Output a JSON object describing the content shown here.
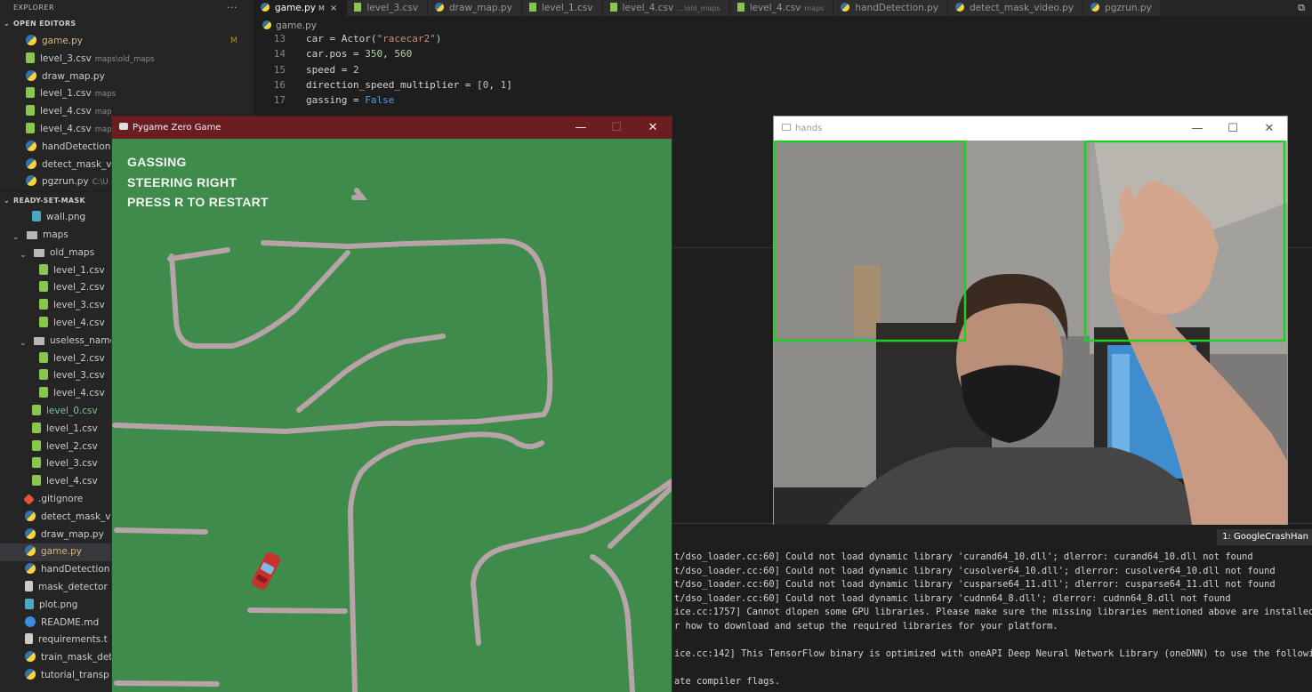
{
  "explorer": {
    "title": "EXPLORER",
    "more_icon": "ellipsis-icon",
    "open_editors_header": "OPEN EDITORS",
    "open_editors": [
      {
        "name": "game.py",
        "type": "py",
        "status": "M"
      },
      {
        "name": "level_3.csv",
        "type": "csv",
        "desc": "maps\\old_maps"
      },
      {
        "name": "draw_map.py",
        "type": "py"
      },
      {
        "name": "level_1.csv",
        "type": "csv",
        "desc": "maps"
      },
      {
        "name": "level_4.csv",
        "type": "csv",
        "desc": "map"
      },
      {
        "name": "level_4.csv",
        "type": "csv",
        "desc": "map"
      },
      {
        "name": "handDetection",
        "type": "py"
      },
      {
        "name": "detect_mask_vi",
        "type": "py"
      },
      {
        "name": "pgzrun.py",
        "type": "py",
        "desc": "C:\\U"
      }
    ],
    "project_header": "READY-SET-MASK",
    "tree": [
      {
        "name": "wall.png",
        "type": "png",
        "indent": 36
      },
      {
        "name": "maps",
        "type": "folder",
        "indent": 14
      },
      {
        "name": "old_maps",
        "type": "folder",
        "indent": 22
      },
      {
        "name": "level_1.csv",
        "type": "csv",
        "indent": 44
      },
      {
        "name": "level_2.csv",
        "type": "csv",
        "indent": 44
      },
      {
        "name": "level_3.csv",
        "type": "csv",
        "indent": 44
      },
      {
        "name": "level_4.csv",
        "type": "csv",
        "indent": 44
      },
      {
        "name": "useless_name",
        "type": "folder",
        "indent": 22
      },
      {
        "name": "level_2.csv",
        "type": "csv",
        "indent": 44
      },
      {
        "name": "level_3.csv",
        "type": "csv",
        "indent": 44
      },
      {
        "name": "level_4.csv",
        "type": "csv",
        "indent": 44
      },
      {
        "name": "level_0.csv",
        "type": "csv",
        "indent": 36,
        "color": "green"
      },
      {
        "name": "level_1.csv",
        "type": "csv",
        "indent": 36
      },
      {
        "name": "level_2.csv",
        "type": "csv",
        "indent": 36
      },
      {
        "name": "level_3.csv",
        "type": "csv",
        "indent": 36
      },
      {
        "name": "level_4.csv",
        "type": "csv",
        "indent": 36
      },
      {
        "name": ".gitignore",
        "type": "git",
        "indent": 28
      },
      {
        "name": "detect_mask_vi",
        "type": "py",
        "indent": 28
      },
      {
        "name": "draw_map.py",
        "type": "py",
        "indent": 28
      },
      {
        "name": "game.py",
        "type": "py",
        "indent": 28,
        "selected": true,
        "color": "yellow"
      },
      {
        "name": "handDetection",
        "type": "py",
        "indent": 28
      },
      {
        "name": "mask_detector",
        "type": "txt",
        "indent": 28
      },
      {
        "name": "plot.png",
        "type": "png",
        "indent": 28
      },
      {
        "name": "README.md",
        "type": "info",
        "indent": 28
      },
      {
        "name": "requirements.t",
        "type": "txt",
        "indent": 28
      },
      {
        "name": "train_mask_det",
        "type": "py",
        "indent": 28
      },
      {
        "name": "tutorial_transp",
        "type": "py",
        "indent": 28
      }
    ]
  },
  "tabs": [
    {
      "label": "game.py",
      "type": "py",
      "active": true,
      "marker": "M"
    },
    {
      "label": "level_3.csv",
      "type": "csv"
    },
    {
      "label": "draw_map.py",
      "type": "py"
    },
    {
      "label": "level_1.csv",
      "type": "csv"
    },
    {
      "label": "level_4.csv",
      "type": "csv",
      "sub": "...\\old_maps"
    },
    {
      "label": "level_4.csv",
      "type": "csv",
      "sub": "maps"
    },
    {
      "label": "handDetection.py",
      "type": "py"
    },
    {
      "label": "detect_mask_video.py",
      "type": "py"
    },
    {
      "label": "pgzrun.py",
      "type": "py"
    }
  ],
  "breadcrumb": "game.py",
  "code_lines": [
    {
      "n": "13",
      "parts": [
        [
          "t-txt",
          "car = Actor("
        ],
        [
          "t-str",
          "\"racecar2\""
        ],
        [
          "t-txt",
          ")"
        ]
      ]
    },
    {
      "n": "14",
      "parts": [
        [
          "t-txt",
          "car.pos = "
        ],
        [
          "t-num",
          "350"
        ],
        [
          "t-txt",
          ", "
        ],
        [
          "t-num",
          "560"
        ]
      ]
    },
    {
      "n": "15",
      "parts": [
        [
          "t-txt",
          "speed = "
        ],
        [
          "t-num",
          "2"
        ]
      ]
    },
    {
      "n": "16",
      "parts": [
        [
          "t-txt",
          "direction_speed_multiplier = ["
        ],
        [
          "t-num",
          "0"
        ],
        [
          "t-txt",
          ", "
        ],
        [
          "t-num",
          "1"
        ],
        [
          "t-txt",
          "]"
        ]
      ]
    },
    {
      "n": "17",
      "parts": [
        [
          "t-txt",
          "gassing = "
        ],
        [
          "t-kw",
          "False"
        ]
      ]
    }
  ],
  "terminal": {
    "tag": "1: GoogleCrashHan",
    "lines": [
      "t/dso_loader.cc:60] Could not load dynamic library 'curand64_10.dll'; dlerror: curand64_10.dll not found",
      "t/dso_loader.cc:60] Could not load dynamic library 'cusolver64_10.dll'; dlerror: cusolver64_10.dll not found",
      "t/dso_loader.cc:60] Could not load dynamic library 'cusparse64_11.dll'; dlerror: cusparse64_11.dll not found",
      "t/dso_loader.cc:60] Could not load dynamic library 'cudnn64_8.dll'; dlerror: cudnn64_8.dll not found",
      "ice.cc:1757] Cannot dlopen some GPU libraries. Please make sure the missing libraries mentioned above are installed",
      "r how to download and setup the required libraries for your platform.",
      "",
      "ice.cc:142] This TensorFlow binary is optimized with oneAPI Deep Neural Network Library (oneDNN) to use the following",
      "",
      "ate compiler flags."
    ]
  },
  "pygame": {
    "title": "Pygame Zero Game",
    "hud": [
      "GASSING",
      "STEERING RIGHT",
      "PRESS R TO RESTART"
    ],
    "colors": {
      "field": "#3f8b4b",
      "titlebar": "#6c1d22",
      "car": "#c8322c"
    }
  },
  "hands": {
    "title": "hands",
    "colors": {
      "box": "#1fd11f"
    }
  },
  "window_controls": {
    "minimize": "—",
    "maximize": "☐",
    "close": "✕"
  }
}
